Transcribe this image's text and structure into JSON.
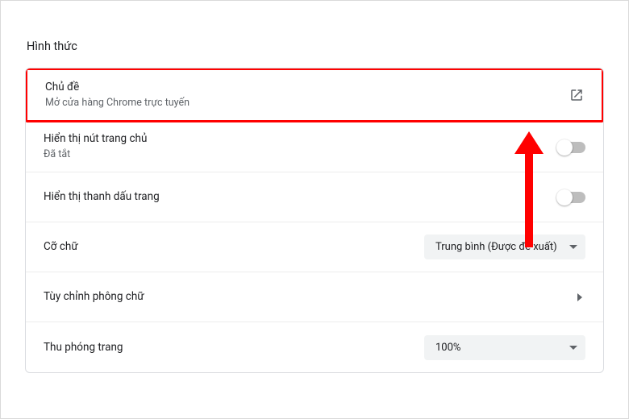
{
  "section_title": "Hình thức",
  "rows": {
    "theme": {
      "label": "Chủ đề",
      "sub": "Mở cửa hàng Chrome trực tuyến"
    },
    "home_button": {
      "label": "Hiển thị nút trang chủ",
      "sub": "Đã tắt"
    },
    "bookmarks_bar": {
      "label": "Hiển thị thanh dấu trang"
    },
    "font_size": {
      "label": "Cỡ chữ",
      "value": "Trung bình (Được đề xuất)"
    },
    "customize_fonts": {
      "label": "Tùy chỉnh phông chữ"
    },
    "page_zoom": {
      "label": "Thu phóng trang",
      "value": "100%"
    }
  }
}
